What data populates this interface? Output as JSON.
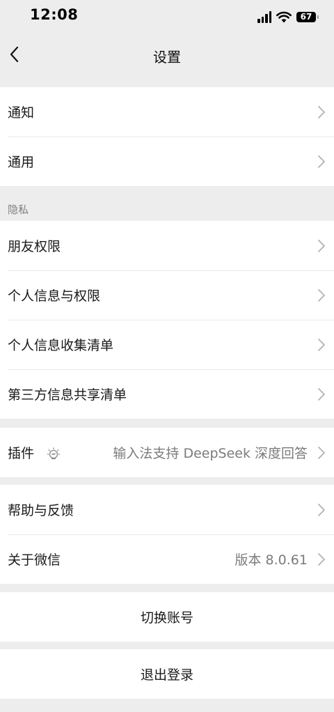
{
  "status_bar": {
    "time": "12:08",
    "battery": "67"
  },
  "nav": {
    "title": "设置"
  },
  "group1": [
    {
      "label": "通知"
    },
    {
      "label": "通用"
    }
  ],
  "privacy": {
    "section_label": "隐私",
    "items": [
      {
        "label": "朋友权限"
      },
      {
        "label": "个人信息与权限"
      },
      {
        "label": "个人信息收集清单"
      },
      {
        "label": "第三方信息共享清单"
      }
    ]
  },
  "plugins": {
    "label": "插件",
    "value": "输入法支持 DeepSeek 深度回答"
  },
  "group4": [
    {
      "label": "帮助与反馈"
    },
    {
      "label": "关于微信",
      "value": "版本 8.0.61"
    }
  ],
  "actions": {
    "switch_account": "切换账号",
    "logout": "退出登录"
  }
}
